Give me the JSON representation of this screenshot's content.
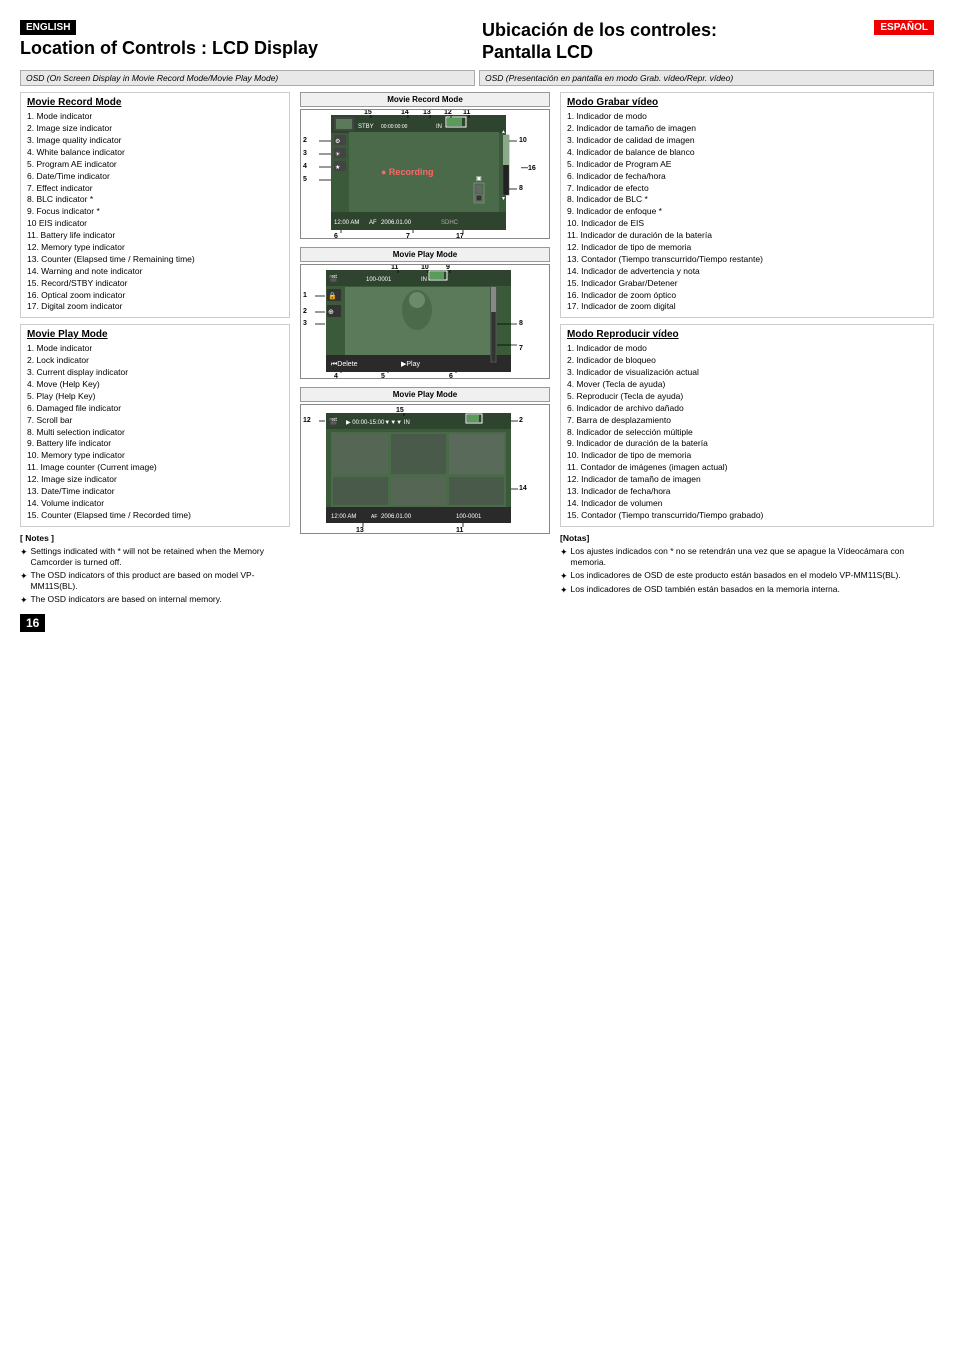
{
  "page": {
    "number": "16",
    "english_badge": "ENGLISH",
    "espanol_badge": "ESPAÑOL",
    "english_title": "Location of Controls : LCD Display",
    "espanol_title": "Ubicación de los controles:\nPantalla LCD",
    "subtitle_english": "OSD (On Screen Display in Movie Record Mode/Movie Play Mode)",
    "subtitle_espanol": "OSD (Presentación en pantalla en modo Grab. vídeo/Repr. vídeo)"
  },
  "english": {
    "record_mode_title": "Movie Record Mode",
    "record_mode_items": [
      "1.   Mode indicator",
      "2.   Image size indicator",
      "3.   Image quality indicator",
      "4.   White balance indicator",
      "5.   Program AE indicator",
      "6.   Date/Time indicator",
      "7.   Effect indicator",
      "8.   BLC indicator *",
      "9.   Focus indicator *",
      "10  EIS indicator",
      "11. Battery life indicator",
      "12. Memory type indicator",
      "13. Counter (Elapsed time / Remaining time)",
      "14. Warning and note indicator",
      "15. Record/STBY indicator",
      "16. Optical zoom indicator",
      "17. Digital zoom indicator"
    ],
    "play_mode_title": "Movie Play Mode",
    "play_mode_items": [
      "1.   Mode indicator",
      "2.   Lock indicator",
      "3.   Current display indicator",
      "4.   Move (Help Key)",
      "5.   Play (Help Key)",
      "6.   Damaged file indicator",
      "7.   Scroll bar",
      "8.   Multi selection indicator",
      "9.   Battery life indicator",
      "10. Memory type indicator",
      "11. Image counter (Current image)",
      "12. Image size indicator",
      "13. Date/Time indicator",
      "14. Volume indicator",
      "15. Counter (Elapsed time / Recorded time)"
    ],
    "notes_title": "[ Notes ]",
    "notes": [
      "Settings indicated with * will not be retained when the Memory Camcorder is turned off.",
      "The OSD indicators of this product are based on model VP-MM11S(BL).",
      "The OSD indicators are based on internal memory."
    ]
  },
  "espanol": {
    "record_mode_title": "Modo Grabar vídeo",
    "record_mode_items": [
      "1.   Indicador de modo",
      "2.   Indicador de tamaño de imagen",
      "3.   Indicador de calidad de imagen",
      "4.   Indicador de balance de blanco",
      "5.   Indicador de Program AE",
      "6.   Indicador de fecha/hora",
      "7.   Indicador de efecto",
      "8.   Indicador de BLC *",
      "9.   Indicador de enfoque *",
      "10. Indicador de EIS",
      "11. Indicador de duración de la batería",
      "12. Indicador de tipo de memoria",
      "13. Contador (Tiempo transcurrido/Tiempo restante)",
      "14. Indicador de advertencia y nota",
      "15. Indicador Grabar/Detener",
      "16. Indicador de zoom óptico",
      "17. Indicador de zoom digital"
    ],
    "play_mode_title": "Modo Reproducir vídeo",
    "play_mode_items": [
      "1.   Indicador de modo",
      "2.   Indicador de bloqueo",
      "3.   Indicador de visualización actual",
      "4.   Mover (Tecla de ayuda)",
      "5.   Reproducir (Tecla de ayuda)",
      "6.   Indicador de archivo dañado",
      "7.   Barra de desplazamiento",
      "8.   Indicador de selección múltiple",
      "9.   Indicador de duración de la batería",
      "10. Indicador de tipo de memoria",
      "11. Contador de imágenes (imagen actual)",
      "12. Indicador de tamaño de imagen",
      "13. Indicador de fecha/hora",
      "14. Indicador de volumen",
      "15. Contador (Tiempo transcurrido/Tiempo grabado)"
    ],
    "notes_title": "[Notas]",
    "notes": [
      "Los ajustes indicados con * no se retendrán una vez que se apague la Vídeocámara con memoria.",
      "Los indicadores de OSD de este producto están basados en el modelo VP-MM11S(BL).",
      "Los indicadores de OSD también están basados en la memoria interna."
    ]
  },
  "diagrams": {
    "record_mode_label": "Movie Record Mode",
    "play_mode1_label": "Movie Play Mode",
    "play_mode2_label": "Movie Play Mode"
  }
}
